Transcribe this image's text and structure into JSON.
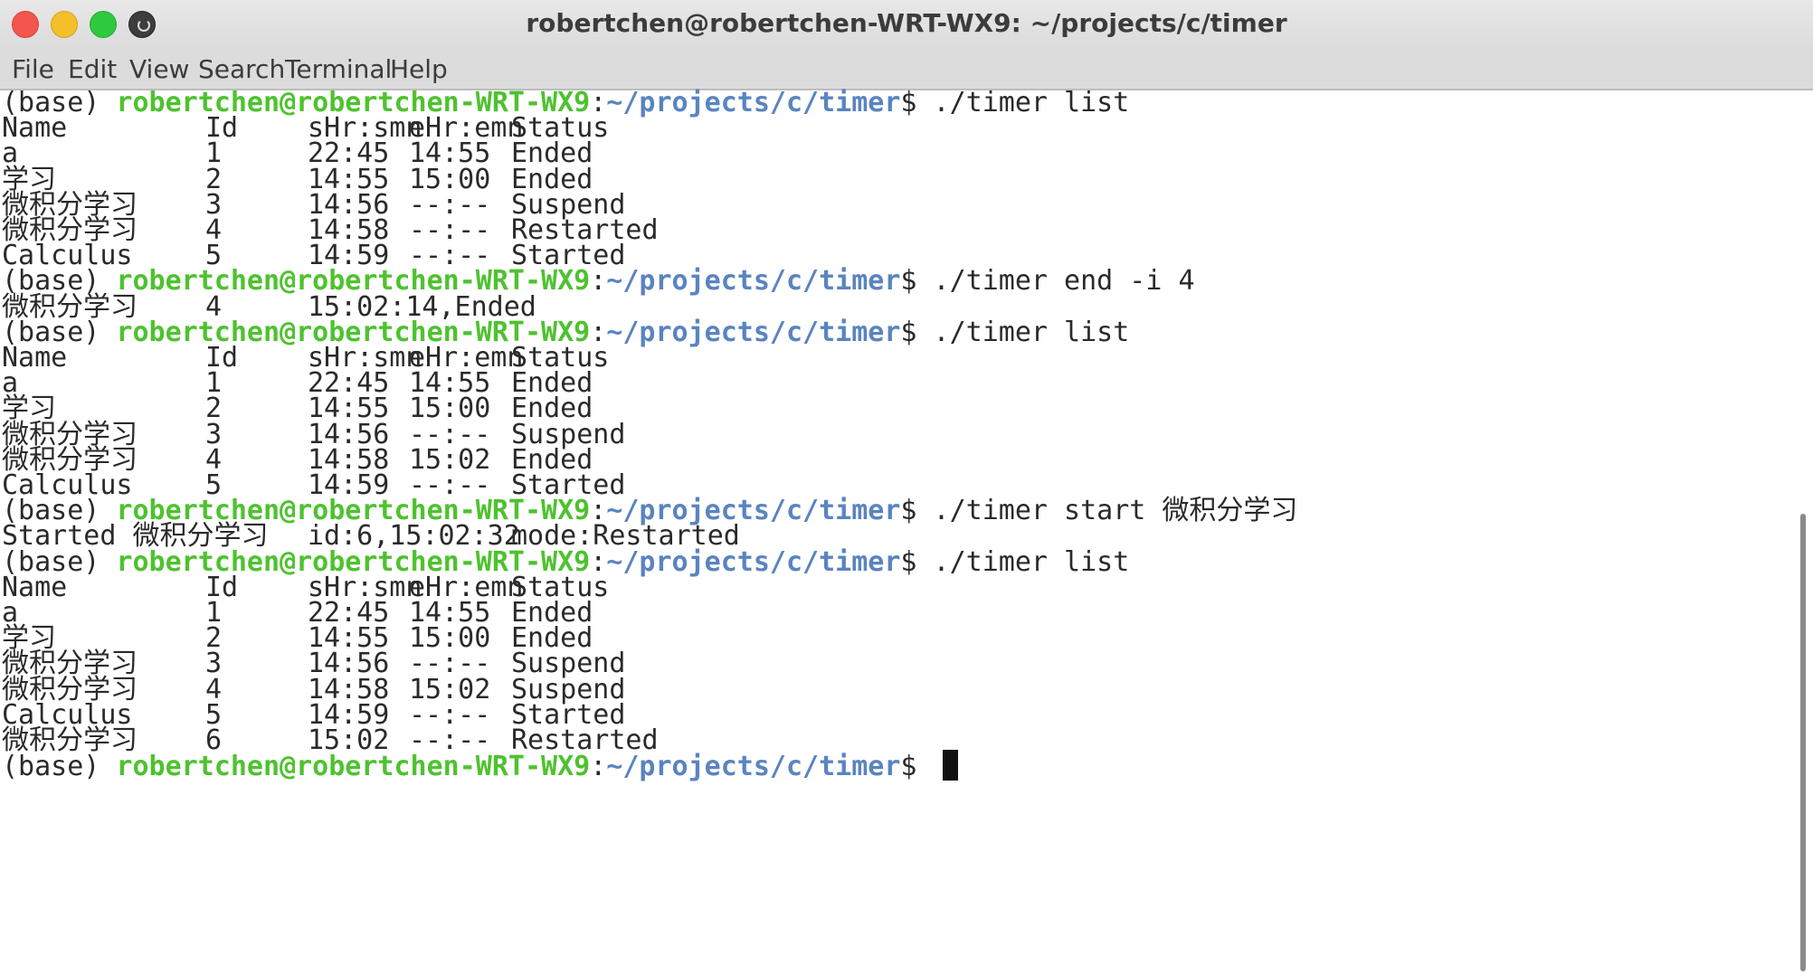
{
  "window": {
    "title": "robertchen@robertchen-WRT-WX9: ~/projects/c/timer"
  },
  "menu": [
    "File",
    "Edit",
    "View",
    "Search",
    "Terminal",
    "Help"
  ],
  "prompt": {
    "env": "(base)",
    "user_host": "robertchen@robertchen-WRT-WX9",
    "colon": ":",
    "path": "~/projects/c/timer",
    "symbol": "$"
  },
  "table_header": [
    "Name",
    "Id",
    "sHr:smn",
    "eHr:emn",
    "Status"
  ],
  "lines": [
    {
      "type": "prompt",
      "command": "./timer list"
    },
    {
      "type": "header"
    },
    {
      "type": "row",
      "cells": [
        "a",
        "1",
        "22:45",
        "14:55",
        "Ended"
      ]
    },
    {
      "type": "row",
      "cells": [
        "学习",
        "2",
        "14:55",
        "15:00",
        "Ended"
      ]
    },
    {
      "type": "row",
      "cells": [
        "微积分学习",
        "3",
        "14:56",
        "--:--",
        "Suspend"
      ]
    },
    {
      "type": "row",
      "cells": [
        "微积分学习",
        "4",
        "14:58",
        "--:--",
        "Restarted"
      ]
    },
    {
      "type": "row",
      "cells": [
        "Calculus",
        "5",
        "14:59",
        "--:--",
        "Started"
      ]
    },
    {
      "type": "prompt",
      "command": "./timer end -i 4"
    },
    {
      "type": "output",
      "cells": [
        "微积分学习",
        "4",
        "15:02:14,Ended"
      ]
    },
    {
      "type": "prompt",
      "command": "./timer list"
    },
    {
      "type": "header"
    },
    {
      "type": "row",
      "cells": [
        "a",
        "1",
        "22:45",
        "14:55",
        "Ended"
      ]
    },
    {
      "type": "row",
      "cells": [
        "学习",
        "2",
        "14:55",
        "15:00",
        "Ended"
      ]
    },
    {
      "type": "row",
      "cells": [
        "微积分学习",
        "3",
        "14:56",
        "--:--",
        "Suspend"
      ]
    },
    {
      "type": "row",
      "cells": [
        "微积分学习",
        "4",
        "14:58",
        "15:02",
        "Ended"
      ]
    },
    {
      "type": "row",
      "cells": [
        "Calculus",
        "5",
        "14:59",
        "--:--",
        "Started"
      ]
    },
    {
      "type": "prompt",
      "command": "./timer start 微积分学习"
    },
    {
      "type": "output2",
      "cells": [
        "Started 微积分学习",
        "id:6,15:02:32",
        "mode:Restarted"
      ]
    },
    {
      "type": "prompt",
      "command": "./timer list"
    },
    {
      "type": "header"
    },
    {
      "type": "row",
      "cells": [
        "a",
        "1",
        "22:45",
        "14:55",
        "Ended"
      ]
    },
    {
      "type": "row",
      "cells": [
        "学习",
        "2",
        "14:55",
        "15:00",
        "Ended"
      ]
    },
    {
      "type": "row",
      "cells": [
        "微积分学习",
        "3",
        "14:56",
        "--:--",
        "Suspend"
      ]
    },
    {
      "type": "row",
      "cells": [
        "微积分学习",
        "4",
        "14:58",
        "15:02",
        "Suspend"
      ]
    },
    {
      "type": "row",
      "cells": [
        "Calculus",
        "5",
        "14:59",
        "--:--",
        "Started"
      ]
    },
    {
      "type": "row",
      "cells": [
        "微积分学习",
        "6",
        "15:02",
        "--:--",
        "Restarted"
      ]
    },
    {
      "type": "prompt",
      "command": "",
      "cursor": true
    }
  ],
  "colors": {
    "prompt_user": "#4ec22f",
    "prompt_path": "#5a84c0",
    "text": "#2a2a2a",
    "background": "#ffffff"
  }
}
